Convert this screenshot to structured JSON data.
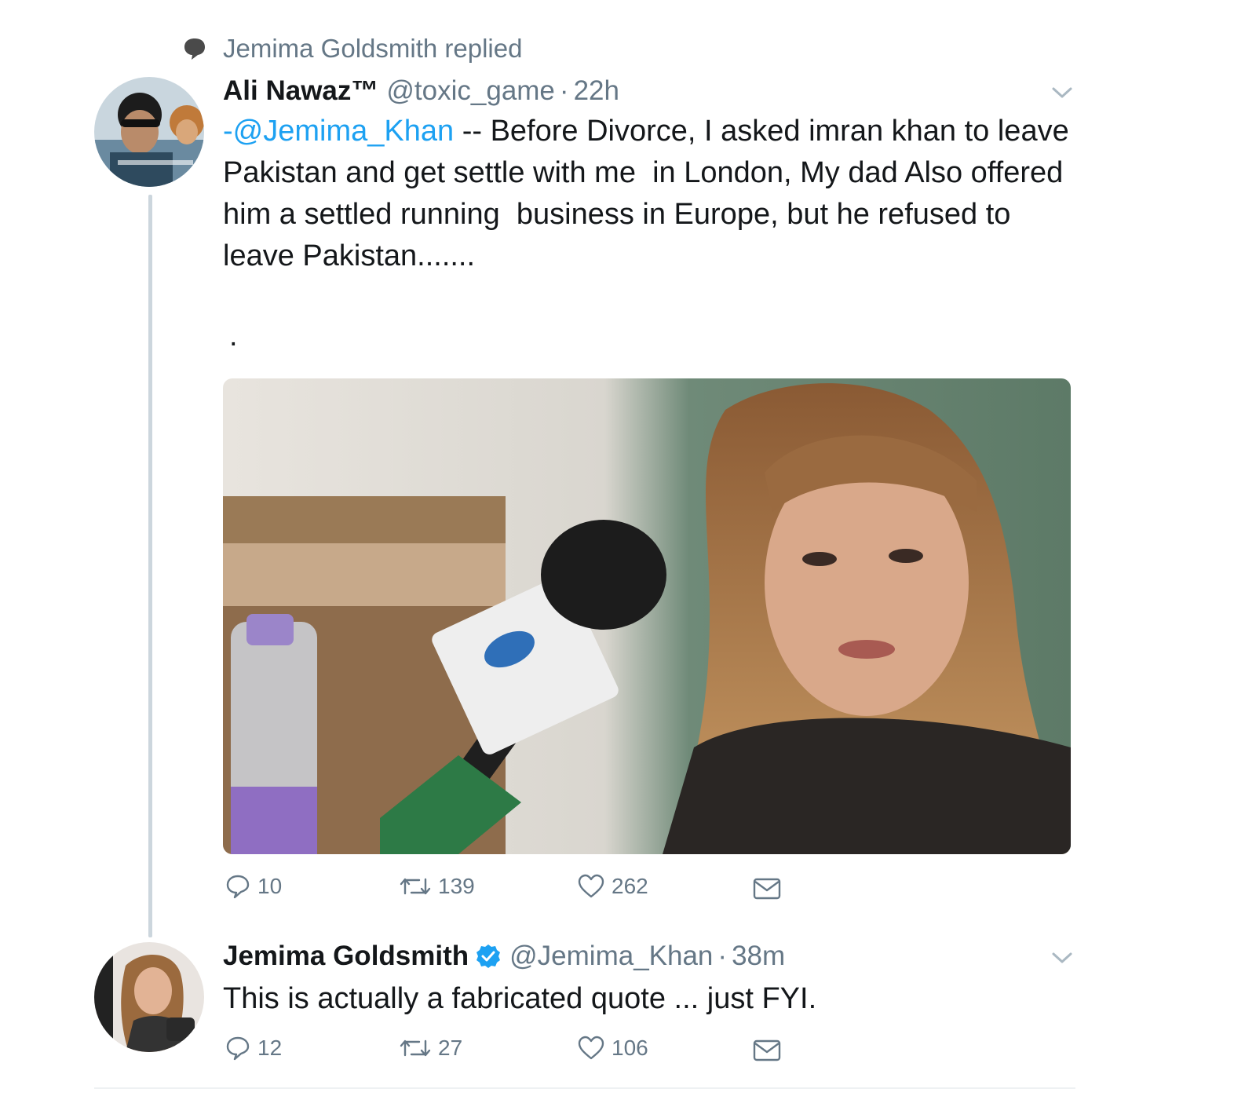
{
  "context": {
    "text": "Jemima Goldsmith replied",
    "icon": "speech-bubble-icon"
  },
  "tweets": [
    {
      "name": "Ali Nawaz™",
      "handle": "@toxic_game",
      "separator": "·",
      "time": "22h",
      "text_mention": "-@Jemima_Khan",
      "text_rest": " -- Before Divorce, I asked imran khan to leave Pakistan and get settle with me  in London, My dad Also offered him a settled running  business in Europe, but he refused to leave Pakistan.......",
      "text_extra": ".",
      "has_media": true,
      "actions": {
        "replies": "10",
        "retweets": "139",
        "likes": "262"
      }
    },
    {
      "name": "Jemima Goldsmith",
      "verified": true,
      "handle": "@Jemima_Khan",
      "separator": "·",
      "time": "38m",
      "text": "This is actually a fabricated quote ... just FYI.",
      "actions": {
        "replies": "12",
        "retweets": "27",
        "likes": "106"
      }
    }
  ],
  "icons": [
    "speech-bubble-icon",
    "chevron-down-icon",
    "reply-icon",
    "retweet-icon",
    "like-icon",
    "message-icon",
    "verified-badge-icon"
  ],
  "colors": {
    "link": "#1da1f2",
    "secondary": "#657786",
    "text": "#14171a",
    "thread_line": "#ccd6dd"
  }
}
